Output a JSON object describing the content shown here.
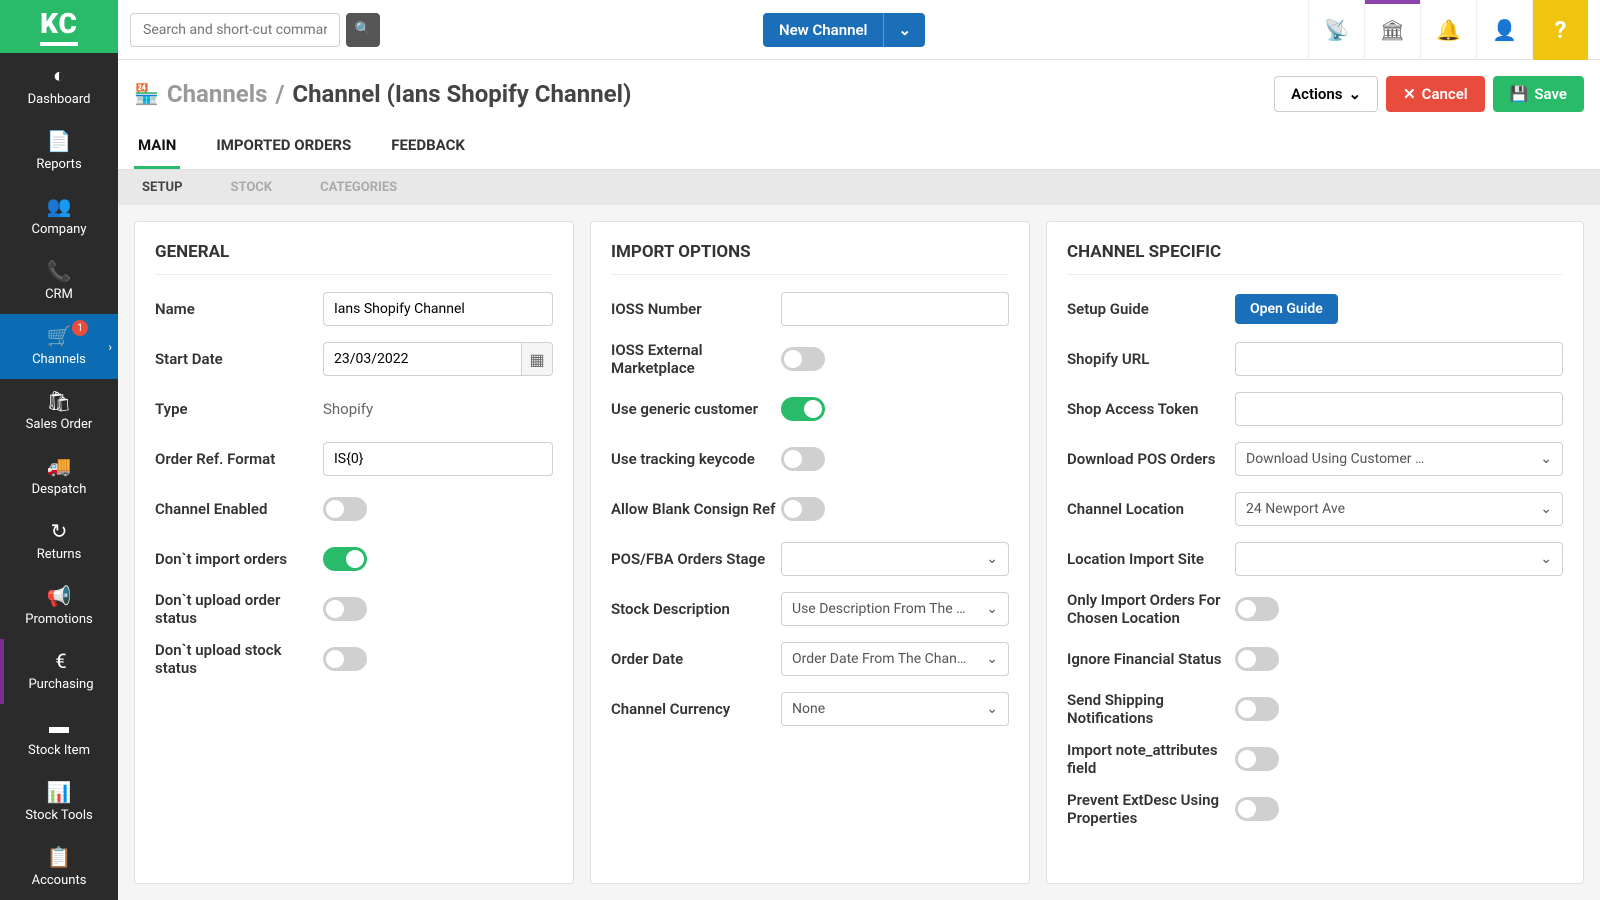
{
  "logo": "KC",
  "sidebar": {
    "items": [
      {
        "label": "Dashboard",
        "icon": "◐"
      },
      {
        "label": "Reports",
        "icon": "📄"
      },
      {
        "label": "Company",
        "icon": "👥"
      },
      {
        "label": "CRM",
        "icon": "📞"
      },
      {
        "label": "Channels",
        "icon": "🛒",
        "active": true,
        "badge": "1",
        "chevron": true
      },
      {
        "label": "Sales Order",
        "icon": "🛍"
      },
      {
        "label": "Despatch",
        "icon": "🚚"
      },
      {
        "label": "Returns",
        "icon": "↻"
      },
      {
        "label": "Promotions",
        "icon": "📢"
      },
      {
        "label": "Purchasing",
        "icon": "€",
        "purpleBorder": true
      },
      {
        "label": "Stock Item",
        "icon": "▬"
      },
      {
        "label": "Stock Tools",
        "icon": "📊"
      },
      {
        "label": "Accounts",
        "icon": "📋"
      }
    ]
  },
  "topbar": {
    "searchPlaceholder": "Search and short-cut commar",
    "newChannel": "New Channel",
    "help": "?"
  },
  "header": {
    "channelsLink": "Channels",
    "separator": "/",
    "title": "Channel (Ians Shopify Channel)",
    "actions": "Actions",
    "cancel": "Cancel",
    "save": "Save"
  },
  "tabs": [
    {
      "label": "MAIN",
      "active": true
    },
    {
      "label": "IMPORTED ORDERS"
    },
    {
      "label": "FEEDBACK"
    }
  ],
  "subtabs": [
    {
      "label": "SETUP",
      "active": true
    },
    {
      "label": "STOCK"
    },
    {
      "label": "CATEGORIES"
    }
  ],
  "panels": {
    "general": {
      "title": "GENERAL",
      "name": {
        "label": "Name",
        "value": "Ians Shopify Channel"
      },
      "startDate": {
        "label": "Start Date",
        "value": "23/03/2022"
      },
      "type": {
        "label": "Type",
        "value": "Shopify"
      },
      "orderRef": {
        "label": "Order Ref. Format",
        "value": "IS{0}"
      },
      "channelEnabled": {
        "label": "Channel Enabled",
        "on": false
      },
      "dontImport": {
        "label": "Don`t import orders",
        "on": true
      },
      "dontUploadOrder": {
        "label": "Don`t upload order status",
        "on": false
      },
      "dontUploadStock": {
        "label": "Don`t upload stock status",
        "on": false
      }
    },
    "import": {
      "title": "IMPORT OPTIONS",
      "ioss": {
        "label": "IOSS Number",
        "value": ""
      },
      "iossExt": {
        "label": "IOSS External Marketplace",
        "on": false
      },
      "generic": {
        "label": "Use generic customer",
        "on": true
      },
      "tracking": {
        "label": "Use tracking keycode",
        "on": false
      },
      "blankConsign": {
        "label": "Allow Blank Consign Ref",
        "on": false
      },
      "posStage": {
        "label": "POS/FBA Orders Stage",
        "value": ""
      },
      "stockDesc": {
        "label": "Stock Description",
        "value": "Use Description From The C…"
      },
      "orderDate": {
        "label": "Order Date",
        "value": "Order Date From The Chan…"
      },
      "currency": {
        "label": "Channel Currency",
        "value": "None"
      }
    },
    "specific": {
      "title": "CHANNEL SPECIFIC",
      "guide": {
        "label": "Setup Guide",
        "btn": "Open Guide"
      },
      "shopifyUrl": {
        "label": "Shopify URL",
        "value": ""
      },
      "accessToken": {
        "label": "Shop Access Token",
        "value": ""
      },
      "downloadPOS": {
        "label": "Download POS Orders",
        "value": "Download Using Customer D…"
      },
      "channelLoc": {
        "label": "Channel Location",
        "value": "24 Newport Ave"
      },
      "importSite": {
        "label": "Location Import Site",
        "value": ""
      },
      "onlyChosen": {
        "label": "Only Import Orders For Chosen Location",
        "on": false
      },
      "ignoreFin": {
        "label": "Ignore Financial Status",
        "on": false
      },
      "shipNotif": {
        "label": "Send Shipping Notifications",
        "on": false
      },
      "noteAttr": {
        "label": "Import note_attributes field",
        "on": false
      },
      "preventExt": {
        "label": "Prevent ExtDesc Using Properties",
        "on": false
      }
    }
  }
}
